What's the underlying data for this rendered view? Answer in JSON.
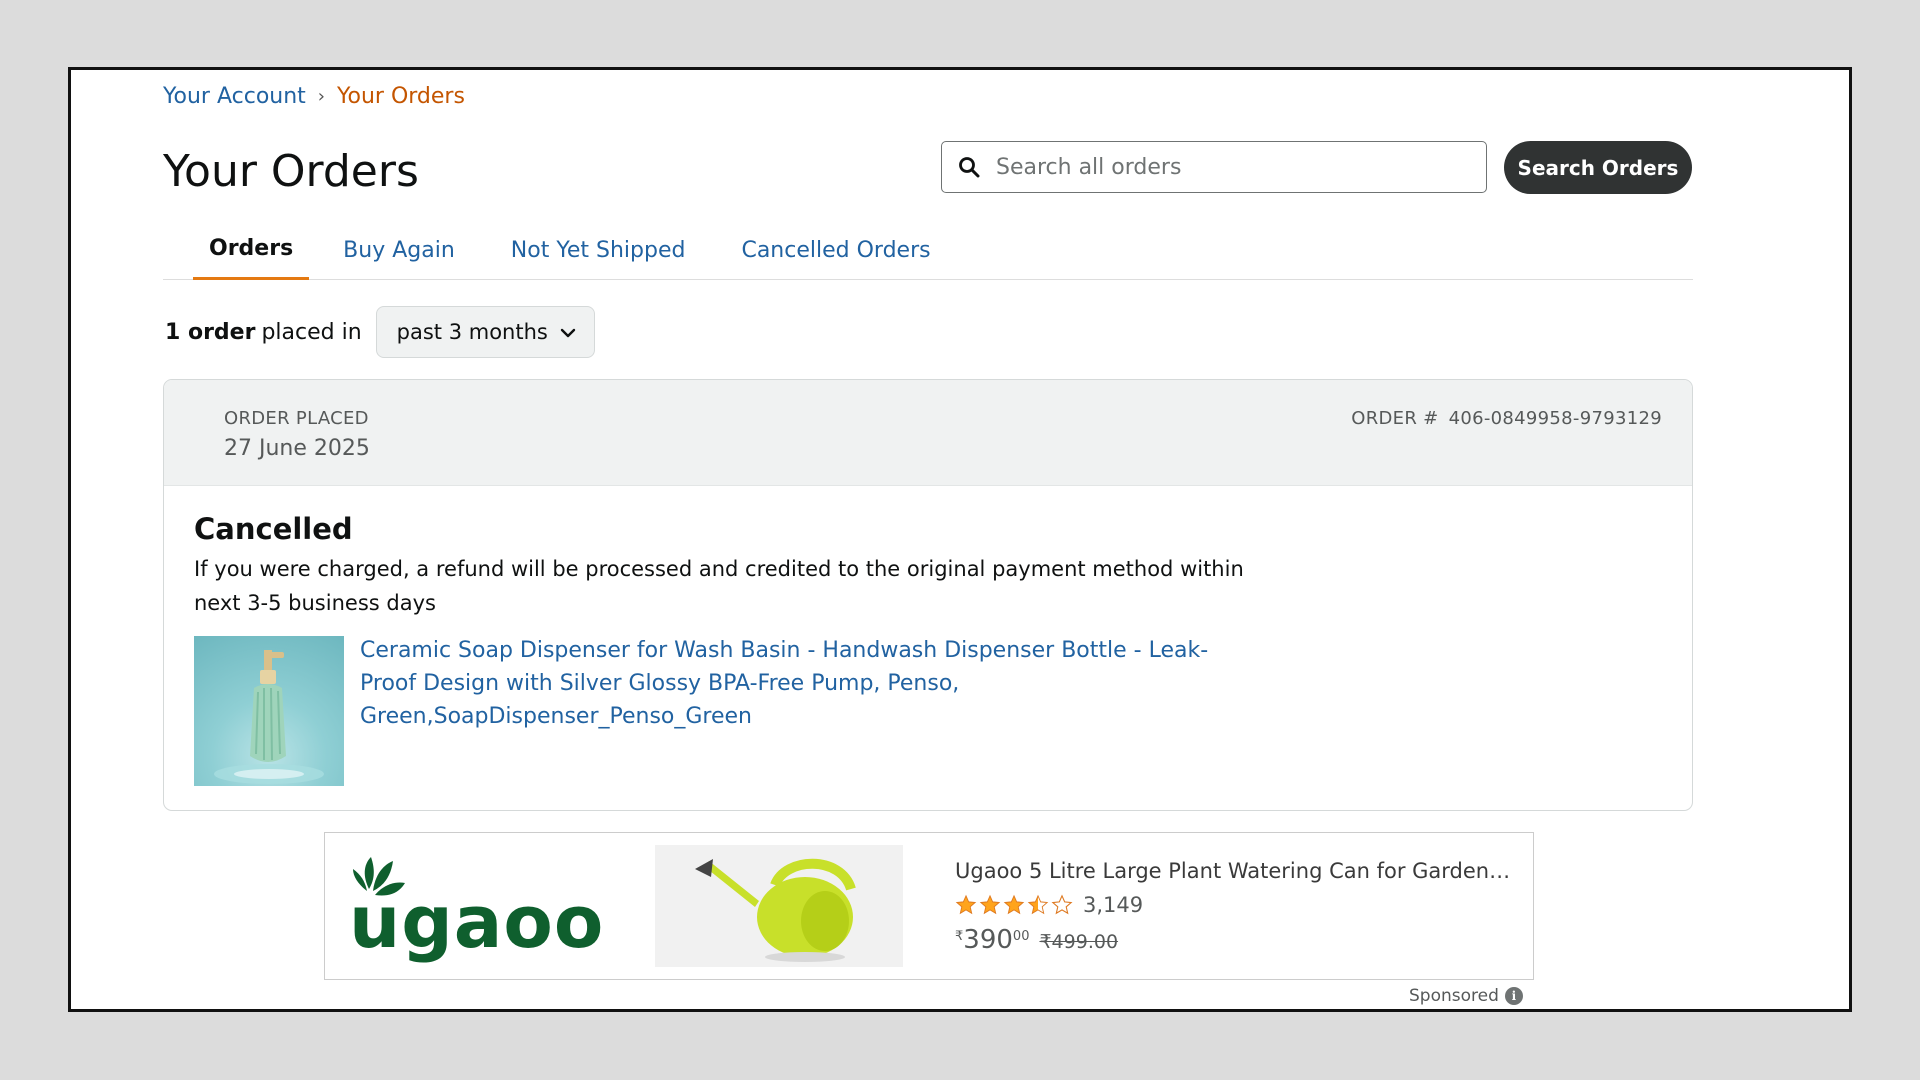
{
  "breadcrumb": {
    "account": "Your Account",
    "separator": "›",
    "current": "Your Orders"
  },
  "page_title": "Your Orders",
  "search": {
    "placeholder": "Search all orders",
    "value": "",
    "button_label": "Search Orders",
    "icon": "search-icon"
  },
  "tabs": [
    {
      "label": "Orders",
      "active": true
    },
    {
      "label": "Buy Again",
      "active": false
    },
    {
      "label": "Not Yet Shipped",
      "active": false
    },
    {
      "label": "Cancelled Orders",
      "active": false
    }
  ],
  "filter": {
    "count_label": "1 order",
    "placed_in": "placed in",
    "period": "past 3 months",
    "icon": "chevron-down-icon"
  },
  "order": {
    "placed_label": "ORDER PLACED",
    "placed_date": "27 June 2025",
    "number_label": "ORDER #",
    "number": "406-0849958-9793129",
    "status": "Cancelled",
    "status_message": "If you were charged, a refund will be processed and credited to the original payment method within next 3-5 business days",
    "product_title": "Ceramic Soap Dispenser for Wash Basin - Handwash Dispenser Bottle - Leak-Proof Design with Silver Glossy BPA-Free Pump, Penso, Green,SoapDispenser_Penso_Green"
  },
  "ad": {
    "brand": "ugaoo",
    "title": "Ugaoo 5 Litre Large Plant Watering Can for Garden-…",
    "rating": 3.5,
    "rating_count": "3,149",
    "currency": "₹",
    "price_whole": "390",
    "price_fraction": "00",
    "mrp": "₹499.00",
    "sponsored_label": "Sponsored",
    "info_glyph": "i"
  },
  "colors": {
    "link": "#2162a1",
    "breadcrumb_current": "#c45500",
    "tab_underline": "#e47911",
    "button_dark": "#303333",
    "brand_green": "#0f5f2e",
    "star": "#ffa41c"
  }
}
